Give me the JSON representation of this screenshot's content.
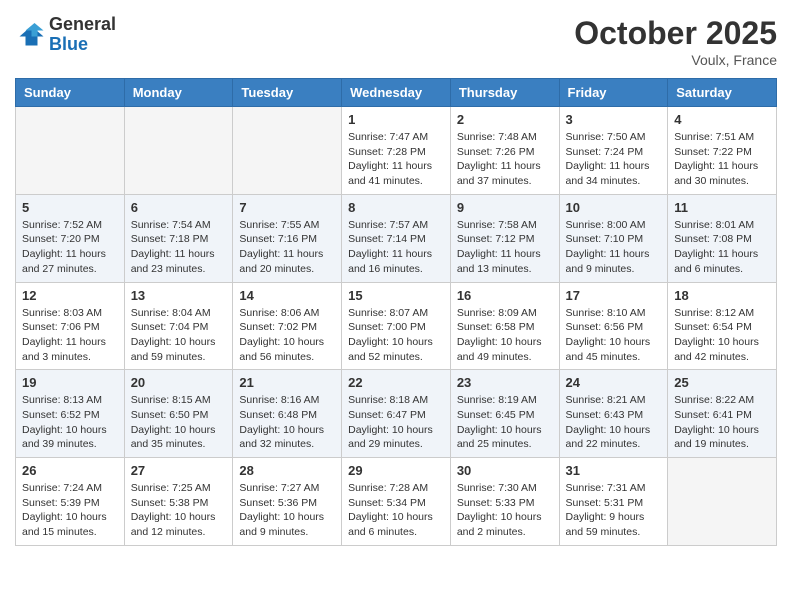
{
  "header": {
    "logo_general": "General",
    "logo_blue": "Blue",
    "month": "October 2025",
    "location": "Voulx, France"
  },
  "weekdays": [
    "Sunday",
    "Monday",
    "Tuesday",
    "Wednesday",
    "Thursday",
    "Friday",
    "Saturday"
  ],
  "weeks": [
    [
      {
        "day": "",
        "sunrise": "",
        "sunset": "",
        "daylight": ""
      },
      {
        "day": "",
        "sunrise": "",
        "sunset": "",
        "daylight": ""
      },
      {
        "day": "",
        "sunrise": "",
        "sunset": "",
        "daylight": ""
      },
      {
        "day": "1",
        "sunrise": "Sunrise: 7:47 AM",
        "sunset": "Sunset: 7:28 PM",
        "daylight": "Daylight: 11 hours and 41 minutes."
      },
      {
        "day": "2",
        "sunrise": "Sunrise: 7:48 AM",
        "sunset": "Sunset: 7:26 PM",
        "daylight": "Daylight: 11 hours and 37 minutes."
      },
      {
        "day": "3",
        "sunrise": "Sunrise: 7:50 AM",
        "sunset": "Sunset: 7:24 PM",
        "daylight": "Daylight: 11 hours and 34 minutes."
      },
      {
        "day": "4",
        "sunrise": "Sunrise: 7:51 AM",
        "sunset": "Sunset: 7:22 PM",
        "daylight": "Daylight: 11 hours and 30 minutes."
      }
    ],
    [
      {
        "day": "5",
        "sunrise": "Sunrise: 7:52 AM",
        "sunset": "Sunset: 7:20 PM",
        "daylight": "Daylight: 11 hours and 27 minutes."
      },
      {
        "day": "6",
        "sunrise": "Sunrise: 7:54 AM",
        "sunset": "Sunset: 7:18 PM",
        "daylight": "Daylight: 11 hours and 23 minutes."
      },
      {
        "day": "7",
        "sunrise": "Sunrise: 7:55 AM",
        "sunset": "Sunset: 7:16 PM",
        "daylight": "Daylight: 11 hours and 20 minutes."
      },
      {
        "day": "8",
        "sunrise": "Sunrise: 7:57 AM",
        "sunset": "Sunset: 7:14 PM",
        "daylight": "Daylight: 11 hours and 16 minutes."
      },
      {
        "day": "9",
        "sunrise": "Sunrise: 7:58 AM",
        "sunset": "Sunset: 7:12 PM",
        "daylight": "Daylight: 11 hours and 13 minutes."
      },
      {
        "day": "10",
        "sunrise": "Sunrise: 8:00 AM",
        "sunset": "Sunset: 7:10 PM",
        "daylight": "Daylight: 11 hours and 9 minutes."
      },
      {
        "day": "11",
        "sunrise": "Sunrise: 8:01 AM",
        "sunset": "Sunset: 7:08 PM",
        "daylight": "Daylight: 11 hours and 6 minutes."
      }
    ],
    [
      {
        "day": "12",
        "sunrise": "Sunrise: 8:03 AM",
        "sunset": "Sunset: 7:06 PM",
        "daylight": "Daylight: 11 hours and 3 minutes."
      },
      {
        "day": "13",
        "sunrise": "Sunrise: 8:04 AM",
        "sunset": "Sunset: 7:04 PM",
        "daylight": "Daylight: 10 hours and 59 minutes."
      },
      {
        "day": "14",
        "sunrise": "Sunrise: 8:06 AM",
        "sunset": "Sunset: 7:02 PM",
        "daylight": "Daylight: 10 hours and 56 minutes."
      },
      {
        "day": "15",
        "sunrise": "Sunrise: 8:07 AM",
        "sunset": "Sunset: 7:00 PM",
        "daylight": "Daylight: 10 hours and 52 minutes."
      },
      {
        "day": "16",
        "sunrise": "Sunrise: 8:09 AM",
        "sunset": "Sunset: 6:58 PM",
        "daylight": "Daylight: 10 hours and 49 minutes."
      },
      {
        "day": "17",
        "sunrise": "Sunrise: 8:10 AM",
        "sunset": "Sunset: 6:56 PM",
        "daylight": "Daylight: 10 hours and 45 minutes."
      },
      {
        "day": "18",
        "sunrise": "Sunrise: 8:12 AM",
        "sunset": "Sunset: 6:54 PM",
        "daylight": "Daylight: 10 hours and 42 minutes."
      }
    ],
    [
      {
        "day": "19",
        "sunrise": "Sunrise: 8:13 AM",
        "sunset": "Sunset: 6:52 PM",
        "daylight": "Daylight: 10 hours and 39 minutes."
      },
      {
        "day": "20",
        "sunrise": "Sunrise: 8:15 AM",
        "sunset": "Sunset: 6:50 PM",
        "daylight": "Daylight: 10 hours and 35 minutes."
      },
      {
        "day": "21",
        "sunrise": "Sunrise: 8:16 AM",
        "sunset": "Sunset: 6:48 PM",
        "daylight": "Daylight: 10 hours and 32 minutes."
      },
      {
        "day": "22",
        "sunrise": "Sunrise: 8:18 AM",
        "sunset": "Sunset: 6:47 PM",
        "daylight": "Daylight: 10 hours and 29 minutes."
      },
      {
        "day": "23",
        "sunrise": "Sunrise: 8:19 AM",
        "sunset": "Sunset: 6:45 PM",
        "daylight": "Daylight: 10 hours and 25 minutes."
      },
      {
        "day": "24",
        "sunrise": "Sunrise: 8:21 AM",
        "sunset": "Sunset: 6:43 PM",
        "daylight": "Daylight: 10 hours and 22 minutes."
      },
      {
        "day": "25",
        "sunrise": "Sunrise: 8:22 AM",
        "sunset": "Sunset: 6:41 PM",
        "daylight": "Daylight: 10 hours and 19 minutes."
      }
    ],
    [
      {
        "day": "26",
        "sunrise": "Sunrise: 7:24 AM",
        "sunset": "Sunset: 5:39 PM",
        "daylight": "Daylight: 10 hours and 15 minutes."
      },
      {
        "day": "27",
        "sunrise": "Sunrise: 7:25 AM",
        "sunset": "Sunset: 5:38 PM",
        "daylight": "Daylight: 10 hours and 12 minutes."
      },
      {
        "day": "28",
        "sunrise": "Sunrise: 7:27 AM",
        "sunset": "Sunset: 5:36 PM",
        "daylight": "Daylight: 10 hours and 9 minutes."
      },
      {
        "day": "29",
        "sunrise": "Sunrise: 7:28 AM",
        "sunset": "Sunset: 5:34 PM",
        "daylight": "Daylight: 10 hours and 6 minutes."
      },
      {
        "day": "30",
        "sunrise": "Sunrise: 7:30 AM",
        "sunset": "Sunset: 5:33 PM",
        "daylight": "Daylight: 10 hours and 2 minutes."
      },
      {
        "day": "31",
        "sunrise": "Sunrise: 7:31 AM",
        "sunset": "Sunset: 5:31 PM",
        "daylight": "Daylight: 9 hours and 59 minutes."
      },
      {
        "day": "",
        "sunrise": "",
        "sunset": "",
        "daylight": ""
      }
    ]
  ]
}
